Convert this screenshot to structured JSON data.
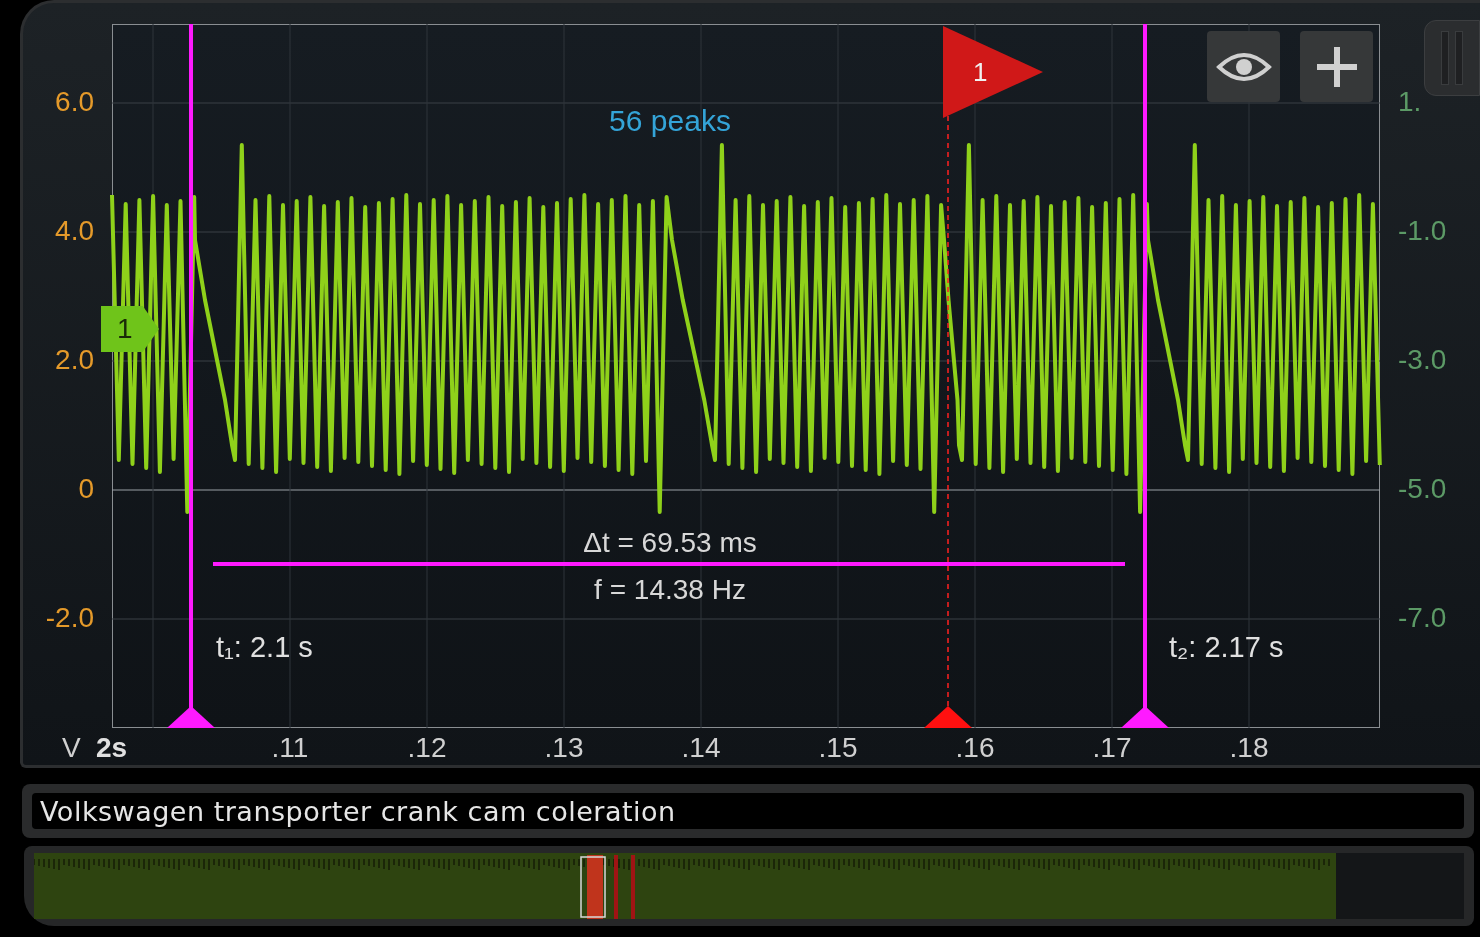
{
  "y_axis_left": {
    "unit": "V",
    "ticks": [
      "6.0",
      "4.0",
      "2.0",
      "0",
      "-2.0"
    ]
  },
  "y_axis_right": {
    "ticks": [
      "1.",
      "-1.0",
      "-3.0",
      "-5.0",
      "-7.0"
    ]
  },
  "x_axis": {
    "start_label": "2s",
    "ticks": [
      ".11",
      ".12",
      ".13",
      ".14",
      ".15",
      ".16",
      ".17",
      ".18"
    ]
  },
  "peak_count": "56 peaks",
  "channel_marker": {
    "label": "1"
  },
  "trigger_flag": {
    "label": "1"
  },
  "toolbar": [
    {
      "kind": "eye"
    },
    {
      "kind": "add"
    }
  ],
  "cursors": [
    {
      "label": "t₁: 2.1 s"
    },
    {
      "label": "t₂: 2.17 s"
    }
  ],
  "measurement": {
    "delta": "Δt = 69.53 ms",
    "frequency": "f = 14.38 Hz"
  },
  "title": "Volkswagen transporter crank cam coleration"
}
